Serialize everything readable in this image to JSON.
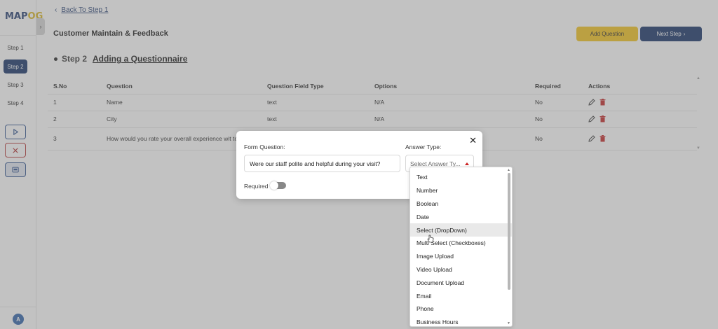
{
  "brand": {
    "logo_part1": "MAP",
    "logo_part2": "OG"
  },
  "sidebar": {
    "steps": [
      "Step 1",
      "Step 2",
      "Step 3",
      "Step 4"
    ],
    "active_step": "Step 2",
    "avatar_initial": "A"
  },
  "header": {
    "back_label": "Back To Step 1",
    "page_title": "Customer Maintain & Feedback",
    "add_question_label": "Add Question",
    "next_step_label": "Next Step"
  },
  "section": {
    "step_label": "Step 2",
    "title": "Adding a Questionnaire"
  },
  "table": {
    "columns": [
      "S.No",
      "Question",
      "Question Field Type",
      "Options",
      "Required",
      "Actions"
    ],
    "rows": [
      {
        "sno": "1",
        "question": "Name",
        "type": "text",
        "options": "N/A",
        "required": "No"
      },
      {
        "sno": "2",
        "question": "City",
        "type": "text",
        "options": "N/A",
        "required": "No"
      },
      {
        "sno": "3",
        "question": "How would you rate your overall experience wit today?",
        "type": "",
        "options": "",
        "required": "No"
      }
    ]
  },
  "modal": {
    "form_question_label": "Form Question:",
    "form_question_value": "Were our staff polite and helpful during your visit?",
    "answer_type_label": "Answer Type:",
    "answer_type_placeholder": "Select Answer Ty...",
    "required_label": "Required",
    "required_on": false
  },
  "answer_type_options": [
    "Text",
    "Number",
    "Boolean",
    "Date",
    "Select (DropDown)",
    "Multi Select (Checkboxes)",
    "Image Upload",
    "Video Upload",
    "Document Upload",
    "Email",
    "Phone",
    "Business Hours"
  ],
  "hovered_option": "Select (DropDown)",
  "colors": {
    "primary": "#0f2d63",
    "accent": "#f2c217",
    "danger": "#c22222"
  }
}
